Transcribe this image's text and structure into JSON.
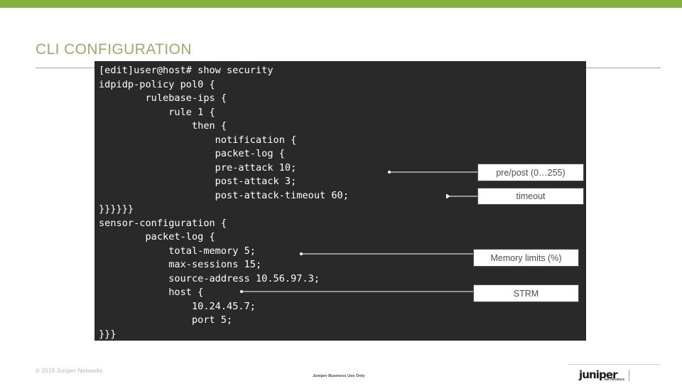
{
  "slide": {
    "title": "CLI CONFIGURATION",
    "accent_color": "#84b23e",
    "title_color": "#9aab6a",
    "code_bg_color": "#292929"
  },
  "code": {
    "language": "junos-cli",
    "text": "[edit]user@host# show security\nidpidp-policy pol0 {\n        rulebase-ips {\n            rule 1 {\n                then {\n                    notification {\n                    packet-log {\n                    pre-attack 10;\n                    post-attack 3;\n                    post-attack-timeout 60;\n}}}}}}\nsensor-configuration {\n        packet-log {\n            total-memory 5;\n            max-sessions 15;\n            source-address 10.56.97.3;\n            host {\n                10.24.45.7;\n                port 5;\n}}}",
    "lines": [
      "[edit]user@host# show security",
      "idpidp-policy pol0 {",
      "        rulebase-ips {",
      "            rule 1 {",
      "                then {",
      "                    notification {",
      "                    packet-log {",
      "                    pre-attack 10;",
      "                    post-attack 3;",
      "                    post-attack-timeout 60;",
      "}}}}}}",
      "sensor-configuration {",
      "        packet-log {",
      "            total-memory 5;",
      "            max-sessions 15;",
      "            source-address 10.56.97.3;",
      "            host {",
      "                10.24.45.7;",
      "                port 5;",
      "}}}"
    ]
  },
  "callouts": [
    {
      "id": "pre-post",
      "label": "pre/post (0…255)"
    },
    {
      "id": "timeout",
      "label": "timeout"
    },
    {
      "id": "memory-limits",
      "label": "Memory limits (%)"
    },
    {
      "id": "strm",
      "label": "STRM"
    }
  ],
  "footer": {
    "copyright": "© 2019 Juniper Networks",
    "center_note": "Juniper Business Use Only",
    "logo_word": "juniper",
    "logo_sub": "NETWORKS"
  }
}
